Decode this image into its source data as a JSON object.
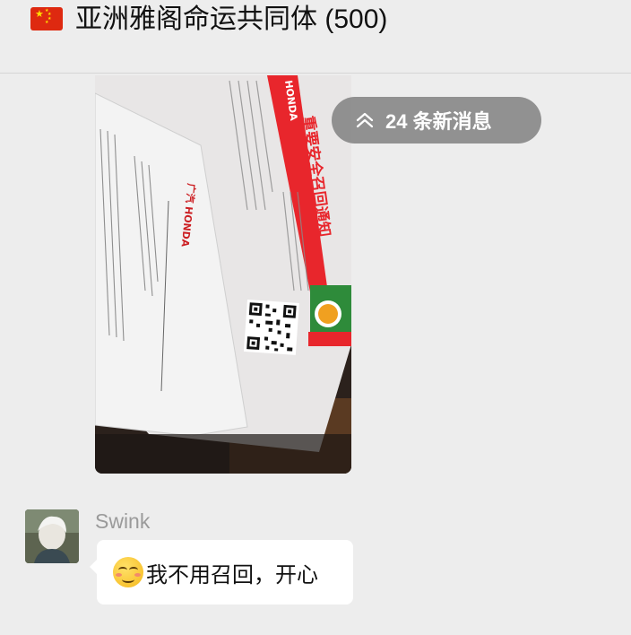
{
  "header": {
    "flag_icon": "china-flag-icon",
    "title": "亚洲雅阁命运共同体 (500)"
  },
  "image_message": {
    "notice_heading": "重要安全召回通知",
    "brand_text": "HONDA"
  },
  "new_messages_badge": {
    "icon": "double-chevron-up-icon",
    "text": "24 条新消息"
  },
  "message": {
    "sender": "Swink",
    "emoji": "flushed-smile-emoji",
    "text": "我不用召回，开心"
  },
  "colors": {
    "background": "#ededed",
    "bubble": "#ffffff",
    "badge": "#808080",
    "notice_red": "#e8262c"
  }
}
